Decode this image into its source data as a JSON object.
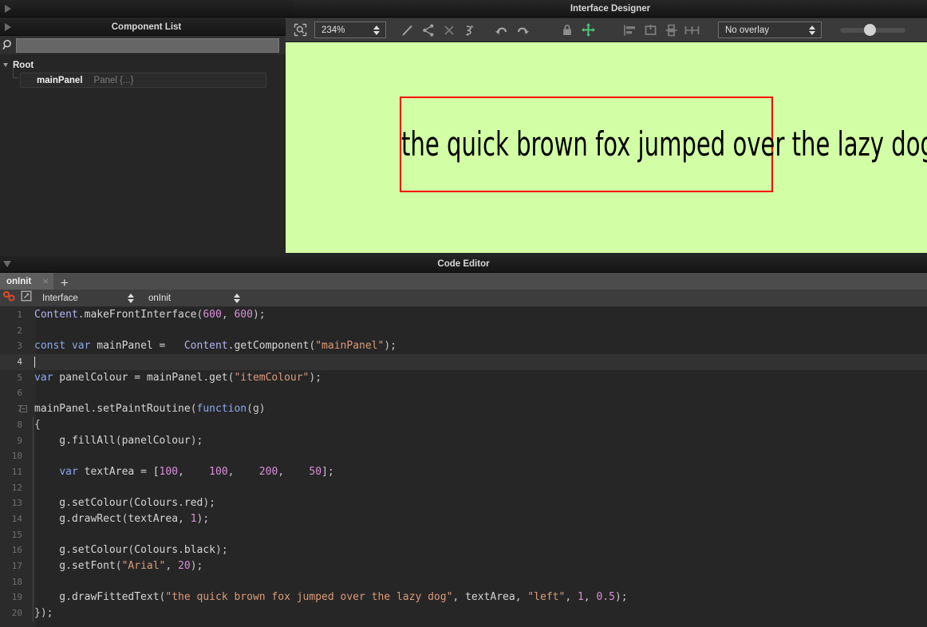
{
  "window": {
    "designer_title": "Interface Designer",
    "code_editor_title": "Code Editor"
  },
  "component_list": {
    "title": "Component List",
    "search_placeholder": "",
    "search_value": "",
    "search_icon": "search-icon",
    "tree": {
      "root_label": "Root",
      "items": [
        {
          "name": "mainPanel",
          "type": "Panel {...}"
        }
      ]
    }
  },
  "designer_toolbar": {
    "zoom_value": "234%",
    "overlay_value": "No overlay",
    "icons": [
      "zoom-select-icon",
      "edit-pencil-icon",
      "share-icon",
      "delete-x-icon",
      "undo-redo-swap-icon",
      "undo-icon",
      "redo-icon",
      "lock-icon",
      "move-icon",
      "align-left-icon",
      "align-center-icon",
      "align-vertical-icon",
      "distribute-horizontal-icon"
    ],
    "slider_value": 45
  },
  "canvas": {
    "background_colour": "#d2ffa5",
    "rect_colour": "#ff0000",
    "text": "the quick brown fox jumped over the lazy dog",
    "text_colour": "#000000",
    "font": "Arial",
    "font_size": 20
  },
  "code_editor": {
    "tabs": [
      {
        "label": "onInit",
        "close": "×"
      }
    ],
    "add_tab": "+",
    "subbar": {
      "link_icon": "link-chain-icon",
      "popout_icon": "external-link-icon",
      "scope_value": "Interface",
      "callback_value": "onInit"
    },
    "active_line": 4,
    "lines": [
      {
        "n": 1,
        "fold": false,
        "tokens": [
          {
            "t": "Content",
            "c": "c-id"
          },
          {
            "t": ".",
            "c": "c-pun"
          },
          {
            "t": "makeFrontInterface",
            "c": "c-fn"
          },
          {
            "t": "(",
            "c": "c-pun"
          },
          {
            "t": "600",
            "c": "c-num"
          },
          {
            "t": ", ",
            "c": "c-pun"
          },
          {
            "t": "600",
            "c": "c-num"
          },
          {
            "t": ");",
            "c": "c-pun"
          }
        ]
      },
      {
        "n": 2,
        "fold": false,
        "tokens": []
      },
      {
        "n": 3,
        "fold": false,
        "tokens": [
          {
            "t": "const",
            "c": "c-kw"
          },
          {
            "t": " ",
            "c": "c-pl"
          },
          {
            "t": "var",
            "c": "c-kw"
          },
          {
            "t": " mainPanel = ",
            "c": "c-pl"
          },
          {
            "t": "  Content",
            "c": "c-id"
          },
          {
            "t": ".",
            "c": "c-pun"
          },
          {
            "t": "getComponent",
            "c": "c-fn"
          },
          {
            "t": "(",
            "c": "c-pun"
          },
          {
            "t": "\"mainPanel\"",
            "c": "c-str"
          },
          {
            "t": ");",
            "c": "c-pun"
          }
        ]
      },
      {
        "n": 4,
        "fold": false,
        "tokens": []
      },
      {
        "n": 5,
        "fold": false,
        "tokens": [
          {
            "t": "var",
            "c": "c-kw"
          },
          {
            "t": " panelColour = mainPanel",
            "c": "c-pl"
          },
          {
            "t": ".",
            "c": "c-pun"
          },
          {
            "t": "get",
            "c": "c-fn"
          },
          {
            "t": "(",
            "c": "c-pun"
          },
          {
            "t": "\"itemColour\"",
            "c": "c-str"
          },
          {
            "t": ");",
            "c": "c-pun"
          }
        ]
      },
      {
        "n": 6,
        "fold": false,
        "tokens": []
      },
      {
        "n": 7,
        "fold": true,
        "tokens": [
          {
            "t": "mainPanel",
            "c": "c-pl"
          },
          {
            "t": ".",
            "c": "c-pun"
          },
          {
            "t": "setPaintRoutine",
            "c": "c-fn"
          },
          {
            "t": "(",
            "c": "c-pun"
          },
          {
            "t": "function",
            "c": "c-kw"
          },
          {
            "t": "(g)",
            "c": "c-pun"
          }
        ]
      },
      {
        "n": 8,
        "fold": false,
        "tokens": [
          {
            "t": "{",
            "c": "c-pun"
          }
        ]
      },
      {
        "n": 9,
        "fold": false,
        "tokens": [
          {
            "t": "    g",
            "c": "c-pl"
          },
          {
            "t": ".",
            "c": "c-pun"
          },
          {
            "t": "fillAll",
            "c": "c-fn"
          },
          {
            "t": "(",
            "c": "c-pun"
          },
          {
            "t": "panelColour",
            "c": "c-pl"
          },
          {
            "t": ");",
            "c": "c-pun"
          }
        ]
      },
      {
        "n": 10,
        "fold": false,
        "tokens": []
      },
      {
        "n": 11,
        "fold": false,
        "tokens": [
          {
            "t": "    ",
            "c": "c-pl"
          },
          {
            "t": "var",
            "c": "c-kw"
          },
          {
            "t": " textArea = [",
            "c": "c-pl"
          },
          {
            "t": "100",
            "c": "c-num"
          },
          {
            "t": ",    ",
            "c": "c-pun"
          },
          {
            "t": "100",
            "c": "c-num"
          },
          {
            "t": ",    ",
            "c": "c-pun"
          },
          {
            "t": "200",
            "c": "c-num"
          },
          {
            "t": ",    ",
            "c": "c-pun"
          },
          {
            "t": "50",
            "c": "c-num"
          },
          {
            "t": "];",
            "c": "c-pun"
          }
        ]
      },
      {
        "n": 12,
        "fold": false,
        "tokens": []
      },
      {
        "n": 13,
        "fold": false,
        "tokens": [
          {
            "t": "    g",
            "c": "c-pl"
          },
          {
            "t": ".",
            "c": "c-pun"
          },
          {
            "t": "setColour",
            "c": "c-fn"
          },
          {
            "t": "(",
            "c": "c-pun"
          },
          {
            "t": "Colours",
            "c": "c-pl"
          },
          {
            "t": ".",
            "c": "c-pun"
          },
          {
            "t": "red",
            "c": "c-pl"
          },
          {
            "t": ");",
            "c": "c-pun"
          }
        ]
      },
      {
        "n": 14,
        "fold": false,
        "tokens": [
          {
            "t": "    g",
            "c": "c-pl"
          },
          {
            "t": ".",
            "c": "c-pun"
          },
          {
            "t": "drawRect",
            "c": "c-fn"
          },
          {
            "t": "(",
            "c": "c-pun"
          },
          {
            "t": "textArea",
            "c": "c-pl"
          },
          {
            "t": ", ",
            "c": "c-pun"
          },
          {
            "t": "1",
            "c": "c-num"
          },
          {
            "t": ");",
            "c": "c-pun"
          }
        ]
      },
      {
        "n": 15,
        "fold": false,
        "tokens": []
      },
      {
        "n": 16,
        "fold": false,
        "tokens": [
          {
            "t": "    g",
            "c": "c-pl"
          },
          {
            "t": ".",
            "c": "c-pun"
          },
          {
            "t": "setColour",
            "c": "c-fn"
          },
          {
            "t": "(",
            "c": "c-pun"
          },
          {
            "t": "Colours",
            "c": "c-pl"
          },
          {
            "t": ".",
            "c": "c-pun"
          },
          {
            "t": "black",
            "c": "c-pl"
          },
          {
            "t": ");",
            "c": "c-pun"
          }
        ]
      },
      {
        "n": 17,
        "fold": false,
        "tokens": [
          {
            "t": "    g",
            "c": "c-pl"
          },
          {
            "t": ".",
            "c": "c-pun"
          },
          {
            "t": "setFont",
            "c": "c-fn"
          },
          {
            "t": "(",
            "c": "c-pun"
          },
          {
            "t": "\"Arial\"",
            "c": "c-str"
          },
          {
            "t": ", ",
            "c": "c-pun"
          },
          {
            "t": "20",
            "c": "c-num"
          },
          {
            "t": ");",
            "c": "c-pun"
          }
        ]
      },
      {
        "n": 18,
        "fold": false,
        "tokens": []
      },
      {
        "n": 19,
        "fold": false,
        "tokens": [
          {
            "t": "    g",
            "c": "c-pl"
          },
          {
            "t": ".",
            "c": "c-pun"
          },
          {
            "t": "drawFittedText",
            "c": "c-fn"
          },
          {
            "t": "(",
            "c": "c-pun"
          },
          {
            "t": "\"the quick brown fox jumped over the lazy dog\"",
            "c": "c-str"
          },
          {
            "t": ", ",
            "c": "c-pun"
          },
          {
            "t": "textArea",
            "c": "c-pl"
          },
          {
            "t": ", ",
            "c": "c-pun"
          },
          {
            "t": "\"left\"",
            "c": "c-str"
          },
          {
            "t": ", ",
            "c": "c-pun"
          },
          {
            "t": "1",
            "c": "c-num"
          },
          {
            "t": ", ",
            "c": "c-pun"
          },
          {
            "t": "0.5",
            "c": "c-num"
          },
          {
            "t": ");",
            "c": "c-pun"
          }
        ]
      },
      {
        "n": 20,
        "fold": false,
        "tokens": [
          {
            "t": "});",
            "c": "c-pun"
          }
        ]
      }
    ]
  }
}
